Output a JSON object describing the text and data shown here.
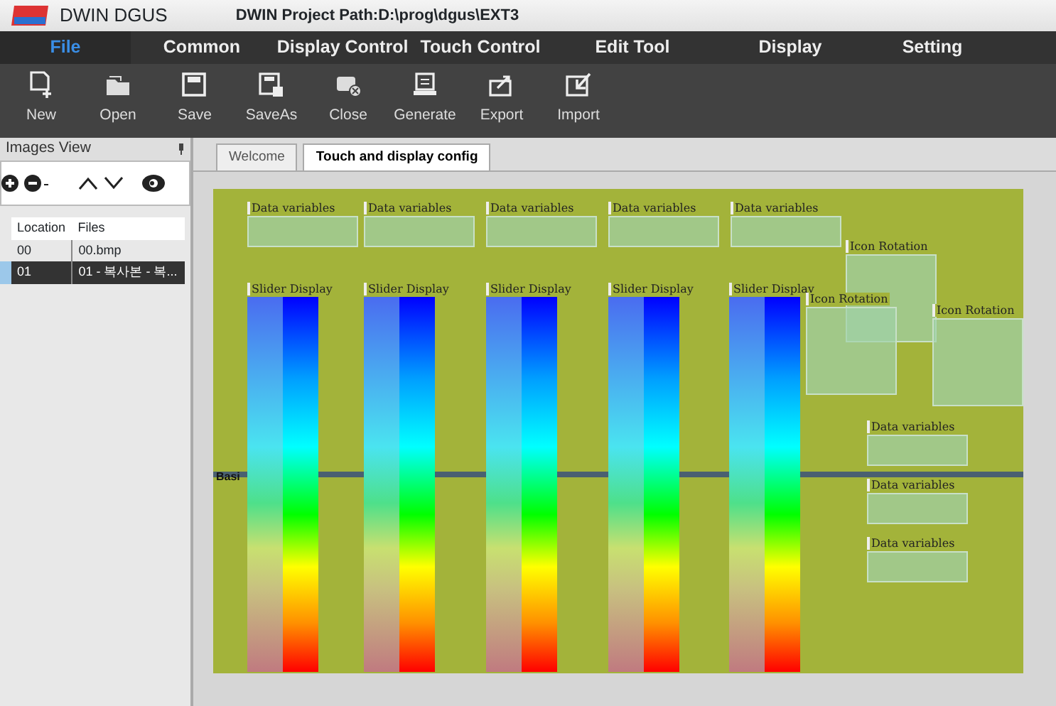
{
  "window": {
    "app_name": "DWIN DGUS",
    "title": "DWIN Project Path:D:\\prog\\dgus\\EXT3"
  },
  "menu": [
    {
      "label": "File",
      "selected": true
    },
    {
      "label": "Common",
      "selected": false
    },
    {
      "label": "Display Control",
      "selected": false
    },
    {
      "label": "Touch Control",
      "selected": false
    },
    {
      "label": "Edit Tool",
      "selected": false
    },
    {
      "label": "Display",
      "selected": false
    },
    {
      "label": "Setting",
      "selected": false
    }
  ],
  "toolbar": [
    "New",
    "Open",
    "Save",
    "SaveAs",
    "Close",
    "Generate",
    "Export",
    "Import"
  ],
  "images_view": {
    "title": "Images View",
    "columns": [
      "Location",
      "Files"
    ],
    "rows": [
      {
        "location": "00",
        "file": "00.bmp",
        "selected": false
      },
      {
        "location": "01",
        "file": "01 - 복사본 - 복...",
        "selected": true
      }
    ]
  },
  "doc_tabs": [
    {
      "label": "Welcome",
      "selected": false
    },
    {
      "label": "Touch and display config",
      "selected": true
    }
  ],
  "canvas": {
    "section_label": "Basi",
    "widgets": [
      {
        "kind": "data",
        "label": "Data variables"
      },
      {
        "kind": "data",
        "label": "Data variables"
      },
      {
        "kind": "data",
        "label": "Data variables"
      },
      {
        "kind": "data",
        "label": "Data variables"
      },
      {
        "kind": "data",
        "label": "Data variables"
      },
      {
        "kind": "slider",
        "label": "Slider Display"
      },
      {
        "kind": "slider",
        "label": "Slider Display"
      },
      {
        "kind": "slider",
        "label": "Slider Display"
      },
      {
        "kind": "slider",
        "label": "Slider Display"
      },
      {
        "kind": "slider",
        "label": "Slider Display"
      },
      {
        "kind": "rotation",
        "label": "Icon Rotation"
      },
      {
        "kind": "rotation",
        "label": "Icon Rotation"
      },
      {
        "kind": "rotation",
        "label": "Icon Rotation"
      },
      {
        "kind": "data",
        "label": "Data variables"
      },
      {
        "kind": "data",
        "label": "Data variables"
      },
      {
        "kind": "data",
        "label": "Data variables"
      }
    ]
  }
}
